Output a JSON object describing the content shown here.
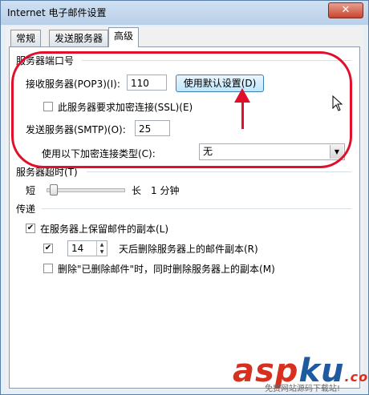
{
  "window": {
    "title": "Internet 电子邮件设置",
    "close_glyph": "✕"
  },
  "tabs": [
    {
      "label": "常规"
    },
    {
      "label": "发送服务器"
    },
    {
      "label": "高级"
    }
  ],
  "server_ports": {
    "group_title": "服务器端口号",
    "incoming_label": "接收服务器(POP3)(I):",
    "incoming_value": "110",
    "default_button": "使用默认设置(D)",
    "ssl_label": "此服务器要求加密连接(SSL)(E)",
    "ssl_checked": false,
    "outgoing_label": "发送服务器(SMTP)(O):",
    "outgoing_value": "25",
    "encryption_label": "使用以下加密连接类型(C):",
    "encryption_value": "无"
  },
  "timeout": {
    "group_title": "服务器超时(T)",
    "short_label": "短",
    "long_label": "长",
    "value_text": "1 分钟"
  },
  "delivery": {
    "group_title": "传递",
    "keep_copy_label": "在服务器上保留邮件的副本(L)",
    "keep_copy_checked": true,
    "remove_after_checked": true,
    "remove_after_days": "14",
    "remove_after_label": "天后删除服务器上的邮件副本(R)",
    "remove_deleted_label": "删除\"已删除邮件\"时，同时删除服务器上的副本(M)",
    "remove_deleted_checked": false
  },
  "watermark": {
    "brand_a": "asp",
    "brand_b": "ku",
    "brand_c": ".com",
    "sub": "免费网站源码下载站!"
  },
  "colors": {
    "annotation": "#e0102a",
    "accent": "#3c7fb1"
  }
}
